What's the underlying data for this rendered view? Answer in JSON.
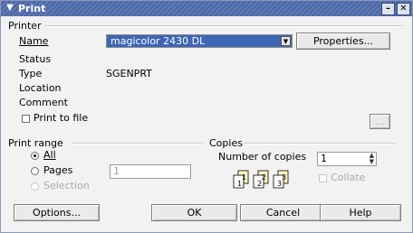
{
  "window": {
    "title": "Print"
  },
  "printer": {
    "group_label": "Printer",
    "name_label": "Name",
    "name_value": "magicolor 2430 DL",
    "properties_button": "Properties...",
    "status_label": "Status",
    "status_value": "",
    "type_label": "Type",
    "type_value": "SGENPRT",
    "location_label": "Location",
    "location_value": "",
    "comment_label": "Comment",
    "comment_value": "",
    "print_to_file_label": "Print to file",
    "browse_button": "..."
  },
  "print_range": {
    "group_label": "Print range",
    "all_label": "All",
    "pages_label": "Pages",
    "pages_value": "1",
    "selection_label": "Selection",
    "selected": "All"
  },
  "copies": {
    "group_label": "Copies",
    "number_label": "Number of copies",
    "number_value": "1",
    "collate_label": "Collate",
    "collate_checked": false
  },
  "buttons": {
    "options": "Options...",
    "ok": "OK",
    "cancel": "Cancel",
    "help": "Help"
  }
}
